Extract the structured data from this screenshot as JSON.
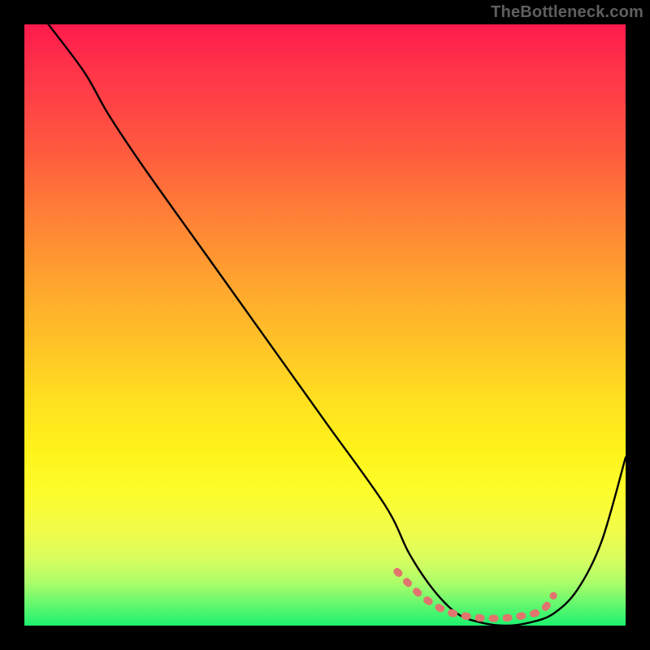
{
  "watermark": "TheBottleneck.com",
  "chart_data": {
    "type": "line",
    "title": "",
    "xlabel": "",
    "ylabel": "",
    "xlim": [
      0,
      100
    ],
    "ylim": [
      0,
      100
    ],
    "grid": false,
    "series": [
      {
        "name": "bottleneck-curve",
        "color": "#000000",
        "x": [
          4,
          10,
          14,
          20,
          30,
          40,
          50,
          60,
          64,
          68,
          72,
          76,
          80,
          84,
          88,
          92,
          96,
          100
        ],
        "y": [
          100,
          92,
          85,
          76,
          62,
          48,
          34,
          20,
          12,
          6,
          2,
          0.5,
          0,
          0.5,
          2,
          6,
          14,
          28
        ]
      },
      {
        "name": "optimal-zone-marker",
        "color": "#e1756e",
        "x": [
          62,
          66,
          70,
          74,
          78,
          82,
          86,
          88
        ],
        "y": [
          9,
          5,
          2.5,
          1.5,
          1.2,
          1.5,
          2.5,
          5
        ]
      }
    ]
  }
}
